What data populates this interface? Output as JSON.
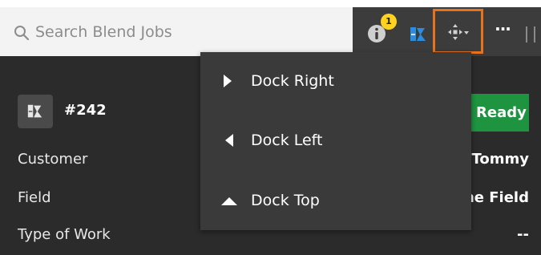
{
  "search": {
    "placeholder": "Search Blend Jobs",
    "value": ""
  },
  "toolbar": {
    "notification_count": "1",
    "icons": [
      "info-icon",
      "blend-job-icon",
      "dock-position-icon",
      "more-icon"
    ],
    "dock_highlight_color": "#e8731c",
    "badge_color": "#ffd21f"
  },
  "dock_menu": {
    "items": [
      {
        "label": "Dock Right",
        "icon": "triangle-right-icon"
      },
      {
        "label": "Dock Left",
        "icon": "triangle-left-icon"
      },
      {
        "label": "Dock Top",
        "icon": "triangle-up-icon"
      }
    ]
  },
  "job": {
    "number": "#242",
    "status": "Ready",
    "status_color": "#1e9440",
    "fields": [
      {
        "label": "Customer",
        "value": "Tommy"
      },
      {
        "label": "Field",
        "value": "ne Field"
      },
      {
        "label": "Type of Work",
        "value": "--"
      }
    ]
  }
}
